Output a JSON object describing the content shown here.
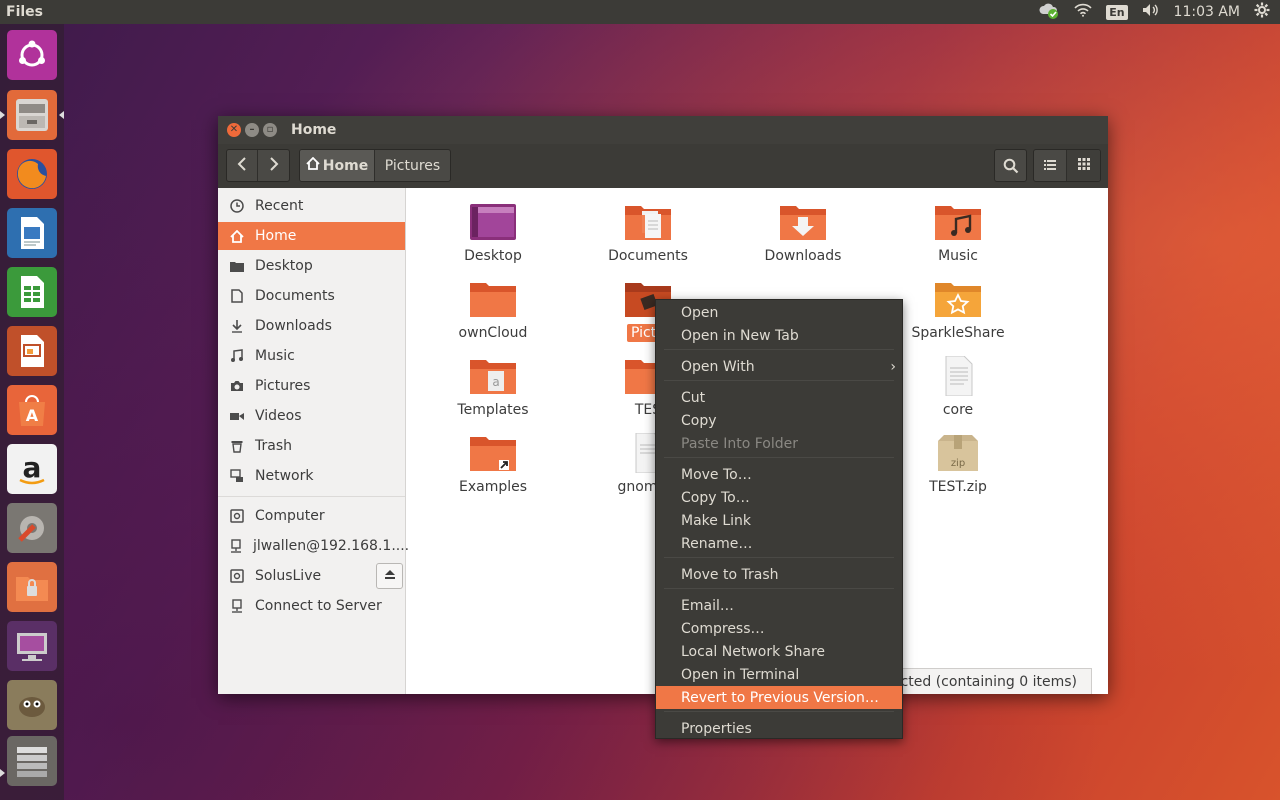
{
  "panel": {
    "app_name": "Files",
    "keyboard_layout": "En",
    "clock": "11:03 AM"
  },
  "launcher": {
    "items": [
      "ubuntu-dash-icon",
      "files-icon",
      "firefox-icon",
      "writer-icon",
      "calc-icon",
      "impress-icon",
      "software-center-icon",
      "amazon-icon",
      "system-settings-icon",
      "privacy-folder-icon",
      "remote-desktop-icon",
      "gimp-icon",
      "scanner-icon"
    ]
  },
  "window": {
    "title": "Home",
    "path": [
      "Home",
      "Pictures"
    ]
  },
  "sidebar": {
    "places": [
      {
        "label": "Recent",
        "icon": "clock-icon"
      },
      {
        "label": "Home",
        "icon": "home-icon",
        "active": true
      },
      {
        "label": "Desktop",
        "icon": "desktop-icon"
      },
      {
        "label": "Documents",
        "icon": "document-icon"
      },
      {
        "label": "Downloads",
        "icon": "download-icon"
      },
      {
        "label": "Music",
        "icon": "music-icon"
      },
      {
        "label": "Pictures",
        "icon": "camera-icon"
      },
      {
        "label": "Videos",
        "icon": "video-icon"
      },
      {
        "label": "Trash",
        "icon": "trash-icon"
      },
      {
        "label": "Network",
        "icon": "network-icon"
      }
    ],
    "devices": [
      {
        "label": "Computer",
        "icon": "drive-icon"
      },
      {
        "label": "jlwallen@192.168.1....",
        "icon": "remote-icon"
      },
      {
        "label": "SolusLive",
        "icon": "drive-icon"
      },
      {
        "label": "Connect to Server",
        "icon": "server-icon"
      }
    ]
  },
  "files": [
    {
      "name": "Desktop"
    },
    {
      "name": "Documents"
    },
    {
      "name": "Downloads"
    },
    {
      "name": "Music"
    },
    {
      "name": "ownCloud"
    },
    {
      "name": "Pictu"
    },
    {
      "name": "SparkleShare"
    },
    {
      "name": "Templates"
    },
    {
      "name": "TES"
    },
    {
      "name": "core"
    },
    {
      "name": "Examples"
    },
    {
      "name": "gnome-s"
    },
    {
      "name": "TEST.zip"
    }
  ],
  "status": "elected  (containing 0 items)",
  "context_menu": {
    "items": [
      {
        "label": "Open"
      },
      {
        "label": "Open in New Tab"
      },
      {
        "label": "Open With"
      },
      {
        "label": "Cut"
      },
      {
        "label": "Copy"
      },
      {
        "label": "Paste Into Folder"
      },
      {
        "label": "Move To…"
      },
      {
        "label": "Copy To…"
      },
      {
        "label": "Make Link"
      },
      {
        "label": "Rename…"
      },
      {
        "label": "Move to Trash"
      },
      {
        "label": "Email…"
      },
      {
        "label": "Compress…"
      },
      {
        "label": "Local Network Share"
      },
      {
        "label": "Open in Terminal"
      },
      {
        "label": "Revert to Previous Version…"
      },
      {
        "label": "Properties"
      }
    ]
  },
  "colors": {
    "accent": "#f07746",
    "panel": "#3c3b37"
  }
}
